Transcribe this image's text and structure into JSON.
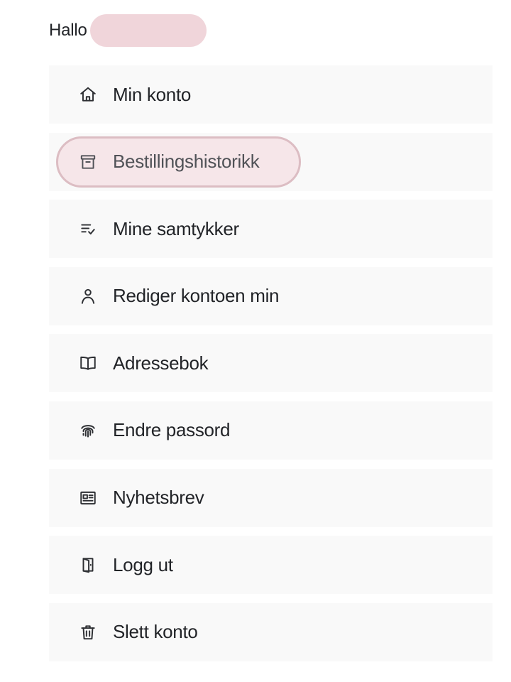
{
  "greeting": {
    "text": "Hallo"
  },
  "menu": {
    "items": [
      {
        "label": "Min konto",
        "icon": "home-icon"
      },
      {
        "label": "Bestillingshistorikk",
        "icon": "archive-icon",
        "active": true
      },
      {
        "label": "Mine samtykker",
        "icon": "list-check-icon"
      },
      {
        "label": "Rediger kontoen min",
        "icon": "user-icon"
      },
      {
        "label": "Adressebok",
        "icon": "book-icon"
      },
      {
        "label": "Endre passord",
        "icon": "fingerprint-icon"
      },
      {
        "label": "Nyhetsbrev",
        "icon": "newspaper-icon"
      },
      {
        "label": "Logg ut",
        "icon": "door-exit-icon"
      },
      {
        "label": "Slett konto",
        "icon": "trash-icon"
      }
    ]
  },
  "colors": {
    "active_pill_bg": "#f6e6e9",
    "active_pill_border": "#dcbdc3",
    "redaction": "#f0d5da",
    "item_bg": "#f9f9f9"
  }
}
